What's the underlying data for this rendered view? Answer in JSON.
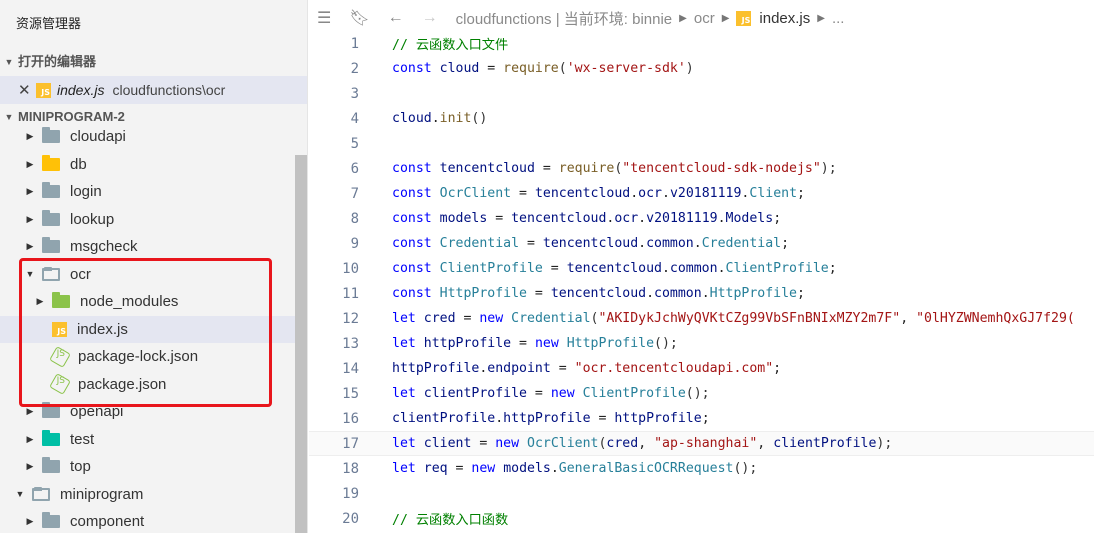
{
  "sidebar": {
    "title": "资源管理器",
    "open_editors": {
      "label": "打开的编辑器",
      "file_name": "index.js",
      "file_path": "cloudfunctions\\ocr"
    },
    "project_label": "MINIPROGRAM-2",
    "tree": [
      {
        "label": "cloudapi",
        "icon": "folder-icon",
        "indent": 1,
        "expanded": false
      },
      {
        "label": "db",
        "icon": "folder-db-icon",
        "indent": 1,
        "expanded": false
      },
      {
        "label": "login",
        "icon": "folder-icon",
        "indent": 1,
        "expanded": false
      },
      {
        "label": "lookup",
        "icon": "folder-icon",
        "indent": 1,
        "expanded": false
      },
      {
        "label": "msgcheck",
        "icon": "folder-icon",
        "indent": 1,
        "expanded": false
      },
      {
        "label": "ocr",
        "icon": "folder-open-icon",
        "indent": 1,
        "expanded": true
      },
      {
        "label": "node_modules",
        "icon": "folder-node-modules-icon",
        "indent": 2,
        "expanded": false
      },
      {
        "label": "index.js",
        "icon": "js-file-icon",
        "indent": 2,
        "selected": true
      },
      {
        "label": "package-lock.json",
        "icon": "json-file-icon",
        "indent": 2
      },
      {
        "label": "package.json",
        "icon": "json-file-icon",
        "indent": 2
      },
      {
        "label": "openapi",
        "icon": "folder-icon",
        "indent": 1,
        "expanded": false
      },
      {
        "label": "test",
        "icon": "folder-test-icon",
        "indent": 1,
        "expanded": false
      },
      {
        "label": "top",
        "icon": "folder-icon",
        "indent": 1,
        "expanded": false
      },
      {
        "label": "miniprogram",
        "icon": "folder-open-icon",
        "indent": 0,
        "expanded": true
      },
      {
        "label": "component",
        "icon": "folder-icon",
        "indent": 1,
        "expanded": false
      }
    ]
  },
  "breadcrumbs": {
    "items": [
      "cloudfunctions | 当前环境: binnie",
      "ocr",
      "index.js",
      "..."
    ]
  },
  "editor": {
    "current_line": 17,
    "lines": [
      {
        "n": "1",
        "tokens": [
          [
            "c",
            "// 云函数入口文件"
          ]
        ]
      },
      {
        "n": "2",
        "tokens": [
          [
            "k",
            "const "
          ],
          [
            "v",
            "cloud"
          ],
          [
            "n",
            " = "
          ],
          [
            "f",
            "require"
          ],
          [
            "p",
            "("
          ],
          [
            "s",
            "'wx-server-sdk'"
          ],
          [
            "p",
            ")"
          ]
        ]
      },
      {
        "n": "3",
        "tokens": []
      },
      {
        "n": "4",
        "tokens": [
          [
            "v",
            "cloud"
          ],
          [
            "n",
            "."
          ],
          [
            "f",
            "init"
          ],
          [
            "p",
            "()"
          ]
        ]
      },
      {
        "n": "5",
        "tokens": []
      },
      {
        "n": "6",
        "tokens": [
          [
            "k",
            "const "
          ],
          [
            "v",
            "tencentcloud"
          ],
          [
            "n",
            " = "
          ],
          [
            "f",
            "require"
          ],
          [
            "p",
            "("
          ],
          [
            "s",
            "\"tencentcloud-sdk-nodejs\""
          ],
          [
            "p",
            ");"
          ]
        ]
      },
      {
        "n": "7",
        "tokens": [
          [
            "k",
            "const "
          ],
          [
            "t",
            "OcrClient"
          ],
          [
            "n",
            " = "
          ],
          [
            "v",
            "tencentcloud"
          ],
          [
            "n",
            "."
          ],
          [
            "v",
            "ocr"
          ],
          [
            "n",
            "."
          ],
          [
            "v",
            "v20181119"
          ],
          [
            "n",
            "."
          ],
          [
            "t",
            "Client"
          ],
          [
            "n",
            ";"
          ]
        ]
      },
      {
        "n": "8",
        "tokens": [
          [
            "k",
            "const "
          ],
          [
            "v",
            "models"
          ],
          [
            "n",
            " = "
          ],
          [
            "v",
            "tencentcloud"
          ],
          [
            "n",
            "."
          ],
          [
            "v",
            "ocr"
          ],
          [
            "n",
            "."
          ],
          [
            "v",
            "v20181119"
          ],
          [
            "n",
            "."
          ],
          [
            "v",
            "Models"
          ],
          [
            "n",
            ";"
          ]
        ]
      },
      {
        "n": "9",
        "tokens": [
          [
            "k",
            "const "
          ],
          [
            "t",
            "Credential"
          ],
          [
            "n",
            " = "
          ],
          [
            "v",
            "tencentcloud"
          ],
          [
            "n",
            "."
          ],
          [
            "v",
            "common"
          ],
          [
            "n",
            "."
          ],
          [
            "t",
            "Credential"
          ],
          [
            "n",
            ";"
          ]
        ]
      },
      {
        "n": "10",
        "tokens": [
          [
            "k",
            "const "
          ],
          [
            "t",
            "ClientProfile"
          ],
          [
            "n",
            " = "
          ],
          [
            "v",
            "tencentcloud"
          ],
          [
            "n",
            "."
          ],
          [
            "v",
            "common"
          ],
          [
            "n",
            "."
          ],
          [
            "t",
            "ClientProfile"
          ],
          [
            "n",
            ";"
          ]
        ]
      },
      {
        "n": "11",
        "tokens": [
          [
            "k",
            "const "
          ],
          [
            "t",
            "HttpProfile"
          ],
          [
            "n",
            " = "
          ],
          [
            "v",
            "tencentcloud"
          ],
          [
            "n",
            "."
          ],
          [
            "v",
            "common"
          ],
          [
            "n",
            "."
          ],
          [
            "t",
            "HttpProfile"
          ],
          [
            "n",
            ";"
          ]
        ]
      },
      {
        "n": "12",
        "tokens": [
          [
            "k",
            "let "
          ],
          [
            "v",
            "cred"
          ],
          [
            "n",
            " = "
          ],
          [
            "k",
            "new "
          ],
          [
            "t",
            "Credential"
          ],
          [
            "p",
            "("
          ],
          [
            "s",
            "\"AKIDykJchWyQVKtCZg99VbSFnBNIxMZY2m7F\""
          ],
          [
            "n",
            ", "
          ],
          [
            "s",
            "\"0lHYZWNemhQxGJ7f29("
          ]
        ]
      },
      {
        "n": "13",
        "tokens": [
          [
            "k",
            "let "
          ],
          [
            "v",
            "httpProfile"
          ],
          [
            "n",
            " = "
          ],
          [
            "k",
            "new "
          ],
          [
            "t",
            "HttpProfile"
          ],
          [
            "p",
            "();"
          ]
        ]
      },
      {
        "n": "14",
        "tokens": [
          [
            "v",
            "httpProfile"
          ],
          [
            "n",
            "."
          ],
          [
            "v",
            "endpoint"
          ],
          [
            "n",
            " = "
          ],
          [
            "s",
            "\"ocr.tencentcloudapi.com\""
          ],
          [
            "n",
            ";"
          ]
        ]
      },
      {
        "n": "15",
        "tokens": [
          [
            "k",
            "let "
          ],
          [
            "v",
            "clientProfile"
          ],
          [
            "n",
            " = "
          ],
          [
            "k",
            "new "
          ],
          [
            "t",
            "ClientProfile"
          ],
          [
            "p",
            "();"
          ]
        ]
      },
      {
        "n": "16",
        "tokens": [
          [
            "v",
            "clientProfile"
          ],
          [
            "n",
            "."
          ],
          [
            "v",
            "httpProfile"
          ],
          [
            "n",
            " = "
          ],
          [
            "v",
            "httpProfile"
          ],
          [
            "n",
            ";"
          ]
        ]
      },
      {
        "n": "17",
        "tokens": [
          [
            "k",
            "let "
          ],
          [
            "v",
            "client"
          ],
          [
            "n",
            " = "
          ],
          [
            "k",
            "new "
          ],
          [
            "t",
            "OcrClient"
          ],
          [
            "p",
            "("
          ],
          [
            "v",
            "cred"
          ],
          [
            "n",
            ", "
          ],
          [
            "s",
            "\"ap-shanghai\""
          ],
          [
            "n",
            ", "
          ],
          [
            "v",
            "clientProfile"
          ],
          [
            "p",
            ");"
          ]
        ]
      },
      {
        "n": "18",
        "tokens": [
          [
            "k",
            "let "
          ],
          [
            "v",
            "req"
          ],
          [
            "n",
            " = "
          ],
          [
            "k",
            "new "
          ],
          [
            "v",
            "models"
          ],
          [
            "n",
            "."
          ],
          [
            "t",
            "GeneralBasicOCRRequest"
          ],
          [
            "p",
            "();"
          ]
        ]
      },
      {
        "n": "19",
        "tokens": []
      },
      {
        "n": "20",
        "tokens": [
          [
            "c",
            "// 云函数入口函数"
          ]
        ]
      }
    ]
  }
}
